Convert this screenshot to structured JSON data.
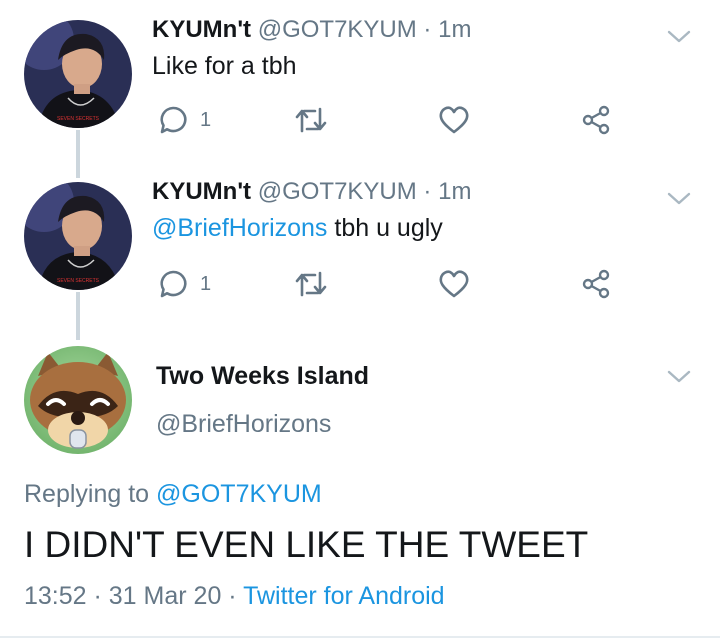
{
  "tweets": [
    {
      "name": "KYUMn't",
      "handle": "@GOT7KYUM",
      "separator": "·",
      "time": "1m",
      "text": "Like for a tbh",
      "reply_count": "1",
      "avatar_shirt_text": "SEVEN SECRETS"
    },
    {
      "name": "KYUMn't",
      "handle": "@GOT7KYUM",
      "separator": "·",
      "time": "1m",
      "mention": "@BriefHorizons",
      "text": " tbh u ugly",
      "reply_count": "1",
      "avatar_shirt_text": "SEVEN SECRETS"
    }
  ],
  "main_tweet": {
    "name": "Two Weeks Island",
    "handle": "@BriefHorizons",
    "replying_prefix": "Replying to ",
    "replying_to": "@GOT7KYUM",
    "text": "I DIDN'T EVEN LIKE THE TWEET",
    "time": "13:52",
    "sep1": " · ",
    "date": "31 Mar 20",
    "sep2": " · ",
    "source": "Twitter for Android"
  },
  "icons": [
    "reply-icon",
    "retweet-icon",
    "like-icon",
    "share-icon",
    "chevron-down-icon"
  ],
  "colors": {
    "link": "#1b95e0",
    "secondary_text": "#657786",
    "icon": "#657786",
    "thread_line": "#ccd6dd"
  }
}
